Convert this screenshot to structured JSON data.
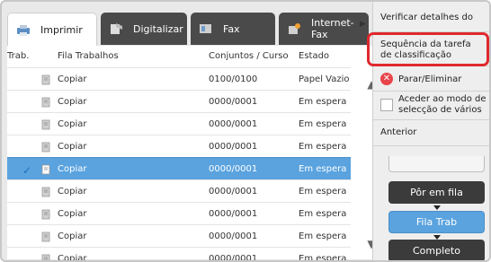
{
  "tabs": [
    {
      "label": "Imprimir",
      "icon": "printer-icon"
    },
    {
      "label": "Digitalizar",
      "icon": "scanner-icon"
    },
    {
      "label": "Fax",
      "icon": "fax-icon"
    },
    {
      "label": "Internet-Fax",
      "icon": "internet-fax-icon"
    }
  ],
  "table": {
    "headers": [
      "Trab.",
      "Fila Trabalhos",
      "Conjuntos / Curso",
      "Estado"
    ],
    "rows": [
      {
        "name": "Copiar",
        "sets": "0100/0100",
        "status": "Papel Vazio",
        "selected": false
      },
      {
        "name": "Copiar",
        "sets": "0000/0001",
        "status": "Em espera",
        "selected": false
      },
      {
        "name": "Copiar",
        "sets": "0000/0001",
        "status": "Em espera",
        "selected": false
      },
      {
        "name": "Copiar",
        "sets": "0000/0001",
        "status": "Em espera",
        "selected": false
      },
      {
        "name": "Copiar",
        "sets": "0000/0001",
        "status": "Em espera",
        "selected": true
      },
      {
        "name": "Copiar",
        "sets": "0000/0001",
        "status": "Em espera",
        "selected": false
      },
      {
        "name": "Copiar",
        "sets": "0000/0001",
        "status": "Em espera",
        "selected": false
      },
      {
        "name": "Copiar",
        "sets": "0000/0001",
        "status": "Em espera",
        "selected": false
      },
      {
        "name": "Copiar",
        "sets": "0000/0001",
        "status": "Em espera",
        "selected": false
      }
    ]
  },
  "menu": {
    "item_verify": "Verificar detalhes do",
    "item_sequence_l1": "Sequência da tarefa",
    "item_sequence_l2": "de classificação",
    "item_stop": "Parar/Eliminar",
    "item_multi_l1": "Aceder ao modo de",
    "item_multi_l2": "selecção de vários",
    "item_previous": "Anterior"
  },
  "buttons": {
    "queue": "Pôr em fila",
    "job_queue": "Fila Trab",
    "complete": "Completo"
  },
  "colors": {
    "selected": "#5aa3df",
    "highlight": "#e0282e",
    "tab_dark": "#4a4a4a"
  }
}
